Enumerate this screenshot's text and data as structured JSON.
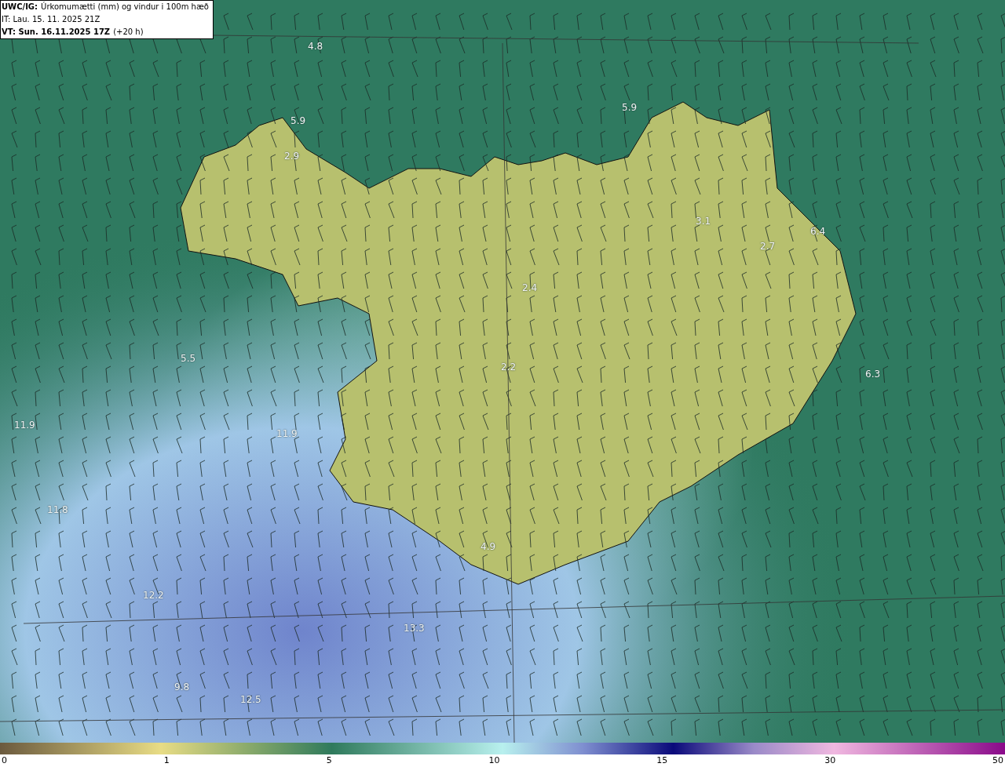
{
  "header": {
    "model": "UWC/IG:",
    "title": "Úrkomumætti (mm) og vindur i 100m hæð",
    "init": "IT: Lau. 15. 11. 2025 21Z",
    "valid": "VT: Sun. 16.11.2025 17Z",
    "lead": "(+20 h)"
  },
  "map_values": [
    "4.8",
    "5.9",
    "2.9",
    "5.9",
    "3.1",
    "6.4",
    "2.7",
    "2.4",
    "5.5",
    "2.2",
    "6.3",
    "11.9",
    "11.9",
    "11.8",
    "4.9",
    "12.2",
    "13.3",
    "9.8",
    "12.5"
  ],
  "colorbar_ticks": [
    "0",
    "1",
    "5",
    "10",
    "15",
    "30",
    "50"
  ]
}
